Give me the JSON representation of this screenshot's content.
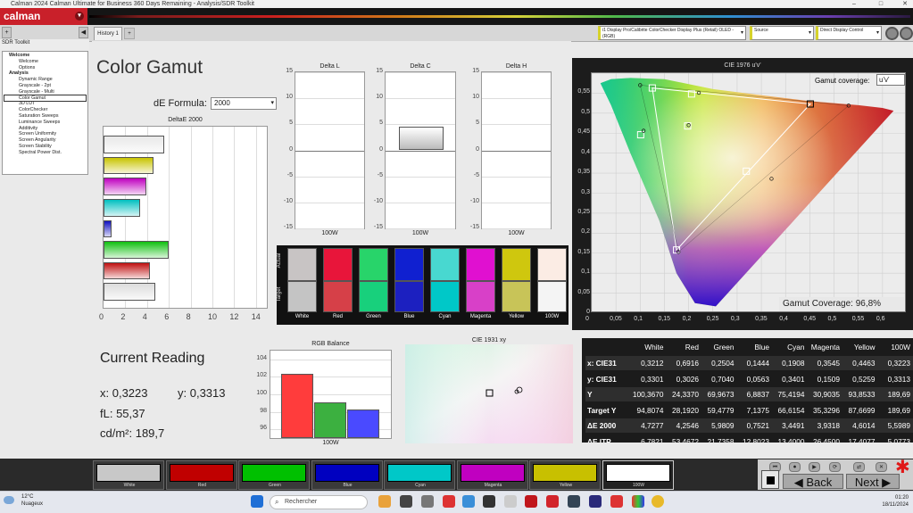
{
  "window": {
    "title": "Calman 2024 Calman Ultimate for Business 360 Days Remaining  - Analysis/SDR Toolkit",
    "controls": [
      "–",
      "□",
      "✕"
    ]
  },
  "brand": {
    "logo": "calman",
    "accent": "#c9202a"
  },
  "toolbar": {
    "history_tab": "History 1",
    "add_tab": "+",
    "meter_source": "i1 Display Pro/Calibrite ColorChecker Display Plus (Retail) OLED - (RGB)",
    "source": "Source",
    "display": "Direct Display Control"
  },
  "sidebar": {
    "header": "SDR Toolkit",
    "items": [
      {
        "label": "Welcome",
        "kind": "group"
      },
      {
        "label": "Welcome",
        "kind": "item"
      },
      {
        "label": "Options",
        "kind": "item"
      },
      {
        "label": "Analysis",
        "kind": "group"
      },
      {
        "label": "Dynamic Range",
        "kind": "item"
      },
      {
        "label": "Grayscale - 2pt",
        "kind": "item"
      },
      {
        "label": "Grayscale - Multi",
        "kind": "item"
      },
      {
        "label": "Color Gamut",
        "kind": "selected"
      },
      {
        "label": "3D LUT",
        "kind": "item"
      },
      {
        "label": "ColorChecker",
        "kind": "item"
      },
      {
        "label": "Saturation Sweeps",
        "kind": "item"
      },
      {
        "label": "Luminance Sweeps",
        "kind": "item"
      },
      {
        "label": "Additivity",
        "kind": "item"
      },
      {
        "label": "Screen Uniformity",
        "kind": "item"
      },
      {
        "label": "Screen Angularity",
        "kind": "item"
      },
      {
        "label": "Screen Stability",
        "kind": "item"
      },
      {
        "label": "Spectral Power Dist.",
        "kind": "item"
      }
    ]
  },
  "page": {
    "title": "Color Gamut",
    "de_formula_label": "dE Formula:",
    "de_formula_value": "2000"
  },
  "chart_data": [
    {
      "type": "bar",
      "title": "DeltaE 2000",
      "orientation": "horizontal",
      "categories": [
        "White",
        "Yellow",
        "Magenta",
        "Cyan",
        "Blue",
        "Green",
        "Red",
        "100W"
      ],
      "values": [
        5.6,
        4.6,
        3.9,
        3.4,
        0.75,
        5.98,
        4.25,
        4.73
      ],
      "colors": [
        "#e8e8e8",
        "#c8c400",
        "#c000c0",
        "#00c0c0",
        "#1010c0",
        "#10c010",
        "#c01010",
        "#dcdcdc"
      ],
      "xlim": [
        0,
        15
      ],
      "xticks": [
        "0",
        "2",
        "4",
        "6",
        "8",
        "10",
        "12",
        "14"
      ]
    },
    {
      "type": "bar",
      "title": "Delta L",
      "categories": [
        "100W"
      ],
      "values": [
        0
      ],
      "ylim": [
        -15,
        15
      ],
      "yticks": [
        "15",
        "10",
        "5",
        "0",
        "-5",
        "-10",
        "-15"
      ]
    },
    {
      "type": "bar",
      "title": "Delta C",
      "categories": [
        "100W"
      ],
      "values": [
        4.6
      ],
      "ylim": [
        -15,
        15
      ],
      "yticks": [
        "15",
        "10",
        "5",
        "0",
        "-5",
        "-10",
        "-15"
      ]
    },
    {
      "type": "bar",
      "title": "Delta H",
      "categories": [
        "100W"
      ],
      "values": [
        0
      ],
      "ylim": [
        -15,
        15
      ],
      "yticks": [
        "15",
        "10",
        "5",
        "0",
        "-5",
        "-10",
        "-15"
      ]
    },
    {
      "type": "bar",
      "title": "RGB Balance",
      "categories": [
        "100W"
      ],
      "series": [
        {
          "name": "R",
          "color": "#ff3c3c",
          "value": 102.3
        },
        {
          "name": "G",
          "color": "#3cb040",
          "value": 99.1
        },
        {
          "name": "B",
          "color": "#4a4aff",
          "value": 98.3
        }
      ],
      "ylim": [
        95,
        105
      ],
      "yticks": [
        "104",
        "102",
        "100",
        "98",
        "96"
      ]
    },
    {
      "type": "scatter",
      "title": "CIE 1976 u'v'",
      "xlim": [
        0,
        0.65
      ],
      "ylim": [
        0,
        0.6
      ],
      "xticks": [
        "0",
        "0,05",
        "0,1",
        "0,15",
        "0,2",
        "0,25",
        "0,3",
        "0,35",
        "0,4",
        "0,45",
        "0,5",
        "0,55",
        "0,6"
      ],
      "yticks": [
        "0,55",
        "0,5",
        "0,45",
        "0,4",
        "0,35",
        "0,3",
        "0,25",
        "0,2",
        "0,15",
        "0,1",
        "0,05",
        "0"
      ],
      "targets": [
        {
          "name": "Red",
          "u": 0.451,
          "v": 0.523
        },
        {
          "name": "Green",
          "u": 0.125,
          "v": 0.563
        },
        {
          "name": "Blue",
          "u": 0.175,
          "v": 0.158
        },
        {
          "name": "Cyan",
          "u": 0.101,
          "v": 0.446
        },
        {
          "name": "Magenta",
          "u": 0.319,
          "v": 0.355
        },
        {
          "name": "Yellow",
          "u": 0.206,
          "v": 0.548
        },
        {
          "name": "White",
          "u": 0.198,
          "v": 0.468
        }
      ],
      "measured": [
        {
          "name": "Red",
          "u": 0.53,
          "v": 0.519
        },
        {
          "name": "Green",
          "u": 0.1,
          "v": 0.57
        },
        {
          "name": "Blue",
          "u": 0.179,
          "v": 0.153
        },
        {
          "name": "Cyan",
          "u": 0.107,
          "v": 0.456
        },
        {
          "name": "Magenta",
          "u": 0.371,
          "v": 0.336
        },
        {
          "name": "Yellow",
          "u": 0.221,
          "v": 0.551
        },
        {
          "name": "White",
          "u": 0.2,
          "v": 0.47
        }
      ]
    }
  ],
  "cie": {
    "title": "CIE 1976 u'v'",
    "coverage_label": "Gamut coverage:",
    "coverage_select": "u'v'",
    "coverage_text": "Gamut Coverage:  96,8%",
    "xy_title": "CIE 1931 xy"
  },
  "delta_labels": {
    "x_label": "100W"
  },
  "swatches": {
    "actual_label": "Actual",
    "target_label": "Target",
    "items": [
      {
        "label": "White",
        "actual": "#c8c4c4",
        "target": "#c4c4c4"
      },
      {
        "label": "Red",
        "actual": "#e8153a",
        "target": "#d64048"
      },
      {
        "label": "Green",
        "actual": "#28d46a",
        "target": "#18d07c"
      },
      {
        "label": "Blue",
        "actual": "#1020d0",
        "target": "#1c20c0"
      },
      {
        "label": "Cyan",
        "actual": "#48d8d0",
        "target": "#00c8c8"
      },
      {
        "label": "Magenta",
        "actual": "#e010d0",
        "target": "#d840c8"
      },
      {
        "label": "Yellow",
        "actual": "#cfc70e",
        "target": "#c8c458"
      },
      {
        "label": "100W",
        "actual": "#fbece4",
        "target": "#f4f4f4"
      }
    ]
  },
  "current_reading": {
    "title": "Current Reading",
    "x": "x: 0,3223",
    "y": "y: 0,3313",
    "fl": "fL: 55,37",
    "cdm2": "cd/m²: 189,7"
  },
  "table": {
    "columns": [
      "White",
      "Red",
      "Green",
      "Blue",
      "Cyan",
      "Magenta",
      "Yellow",
      "100W"
    ],
    "rows": [
      {
        "label": "x: CIE31",
        "values": [
          "0,3212",
          "0,6916",
          "0,2504",
          "0,1444",
          "0,1908",
          "0,3545",
          "0,4463",
          "0,3223"
        ]
      },
      {
        "label": "y: CIE31",
        "values": [
          "0,3301",
          "0,3026",
          "0,7040",
          "0,0563",
          "0,3401",
          "0,1509",
          "0,5259",
          "0,3313"
        ]
      },
      {
        "label": "Y",
        "values": [
          "100,3670",
          "24,3370",
          "69,9673",
          "6,8837",
          "75,4194",
          "30,9035",
          "93,8533",
          "189,69"
        ]
      },
      {
        "label": "Target Y",
        "values": [
          "94,8074",
          "28,1920",
          "59,4779",
          "7,1375",
          "66,6154",
          "35,3296",
          "87,6699",
          "189,69"
        ]
      },
      {
        "label": "ΔE 2000",
        "values": [
          "4,7277",
          "4,2546",
          "5,9809",
          "0,7521",
          "3,4491",
          "3,9318",
          "4,6014",
          "5,5989"
        ]
      },
      {
        "label": "ΔE ITP",
        "values": [
          "6,7821",
          "53,4672",
          "21,7358",
          "12,8023",
          "13,4000",
          "26,4500",
          "17,4077",
          "5,0773"
        ]
      }
    ]
  },
  "patches": [
    {
      "label": "White",
      "color": "#c8c8c8"
    },
    {
      "label": "Red",
      "color": "#c00000"
    },
    {
      "label": "Green",
      "color": "#00c000"
    },
    {
      "label": "Blue",
      "color": "#0000c0"
    },
    {
      "label": "Cyan",
      "color": "#00c8c8"
    },
    {
      "label": "Magenta",
      "color": "#c000c0"
    },
    {
      "label": "Yellow",
      "color": "#c8c000"
    },
    {
      "label": "100W",
      "color": "#ffffff"
    }
  ],
  "nav": {
    "back": "Back",
    "next": "Next"
  },
  "taskbar": {
    "temp": "12°C",
    "weather": "Nuageux",
    "search": "Rechercher",
    "time": "01:20",
    "date": "18/11/2024"
  }
}
